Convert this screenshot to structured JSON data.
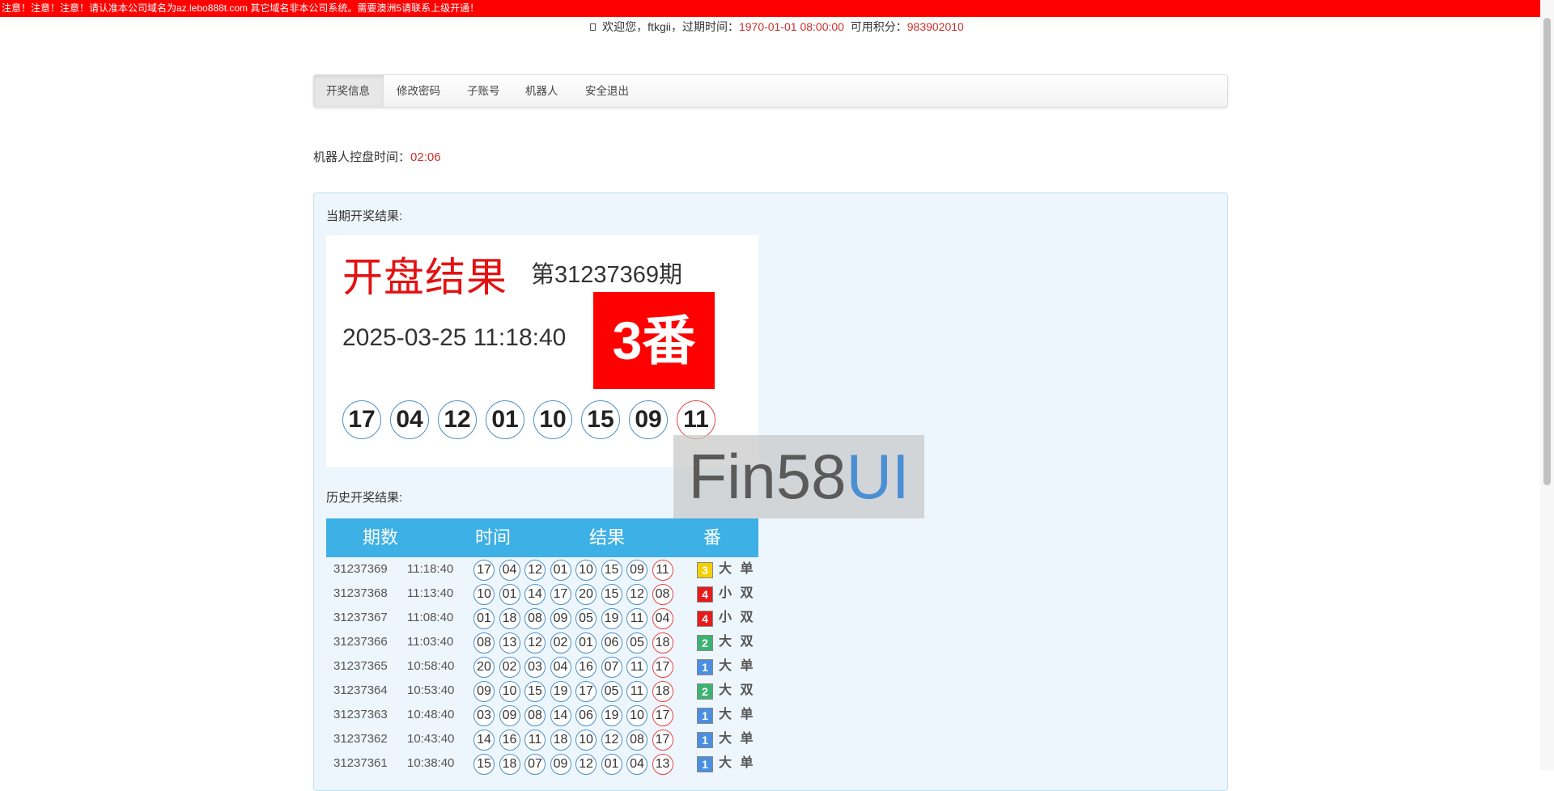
{
  "notice": "注意！注意！注意！请认准本公司域名为az.lebo888t.com 其它域名非本公司系统。需要澳洲5请联系上级开通！",
  "welcome": {
    "icon": "user-icon",
    "prefix": "欢迎您，",
    "username": "ftkgii",
    "expire_label": "，过期时间：",
    "expire_value": "1970-01-01 08:00:00",
    "points_label": "可用积分：",
    "points_value": "983902010"
  },
  "nav": {
    "items": [
      {
        "label": "开奖信息",
        "active": true
      },
      {
        "label": "修改密码"
      },
      {
        "label": "子账号"
      },
      {
        "label": "机器人"
      },
      {
        "label": "安全退出"
      }
    ]
  },
  "robot": {
    "label": "机器人控盘时间：",
    "value": "02:06"
  },
  "current": {
    "section_title": "当期开奖结果:",
    "title": "开盘结果",
    "period": "第31237369期",
    "datetime": "2025-03-25 11:18:40",
    "fan": "3番",
    "balls": [
      "17",
      "04",
      "12",
      "01",
      "10",
      "15",
      "09",
      "11"
    ]
  },
  "history": {
    "section_title": "历史开奖结果:",
    "headers": {
      "issue": "期数",
      "time": "时间",
      "result": "结果",
      "fan": "番"
    },
    "rows": [
      {
        "issue": "31237369",
        "time": "11:18:40",
        "balls": [
          "17",
          "04",
          "12",
          "01",
          "10",
          "15",
          "09",
          "11"
        ],
        "fan": "3",
        "big_small": "大",
        "odd_even": "单"
      },
      {
        "issue": "31237368",
        "time": "11:13:40",
        "balls": [
          "10",
          "01",
          "14",
          "17",
          "20",
          "15",
          "12",
          "08"
        ],
        "fan": "4",
        "big_small": "小",
        "odd_even": "双"
      },
      {
        "issue": "31237367",
        "time": "11:08:40",
        "balls": [
          "01",
          "18",
          "08",
          "09",
          "05",
          "19",
          "11",
          "04"
        ],
        "fan": "4",
        "big_small": "小",
        "odd_even": "双"
      },
      {
        "issue": "31237366",
        "time": "11:03:40",
        "balls": [
          "08",
          "13",
          "12",
          "02",
          "01",
          "06",
          "05",
          "18"
        ],
        "fan": "2",
        "big_small": "大",
        "odd_even": "双"
      },
      {
        "issue": "31237365",
        "time": "10:58:40",
        "balls": [
          "20",
          "02",
          "03",
          "04",
          "16",
          "07",
          "11",
          "17"
        ],
        "fan": "1",
        "big_small": "大",
        "odd_even": "单"
      },
      {
        "issue": "31237364",
        "time": "10:53:40",
        "balls": [
          "09",
          "10",
          "15",
          "19",
          "17",
          "05",
          "11",
          "18"
        ],
        "fan": "2",
        "big_small": "大",
        "odd_even": "双"
      },
      {
        "issue": "31237363",
        "time": "10:48:40",
        "balls": [
          "03",
          "09",
          "08",
          "14",
          "06",
          "19",
          "10",
          "17"
        ],
        "fan": "1",
        "big_small": "大",
        "odd_even": "单"
      },
      {
        "issue": "31237362",
        "time": "10:43:40",
        "balls": [
          "14",
          "16",
          "11",
          "18",
          "10",
          "12",
          "08",
          "17"
        ],
        "fan": "1",
        "big_small": "大",
        "odd_even": "单"
      },
      {
        "issue": "31237361",
        "time": "10:38:40",
        "balls": [
          "15",
          "18",
          "07",
          "09",
          "12",
          "01",
          "04",
          "13"
        ],
        "fan": "1",
        "big_small": "大",
        "odd_even": "单"
      }
    ]
  },
  "fan_colors": {
    "1": "#4a8fe0",
    "2": "#3cb371",
    "3": "#f5d000",
    "4": "#e41c1c"
  },
  "watermark": {
    "text": "Fin58",
    "accent": "UI"
  }
}
